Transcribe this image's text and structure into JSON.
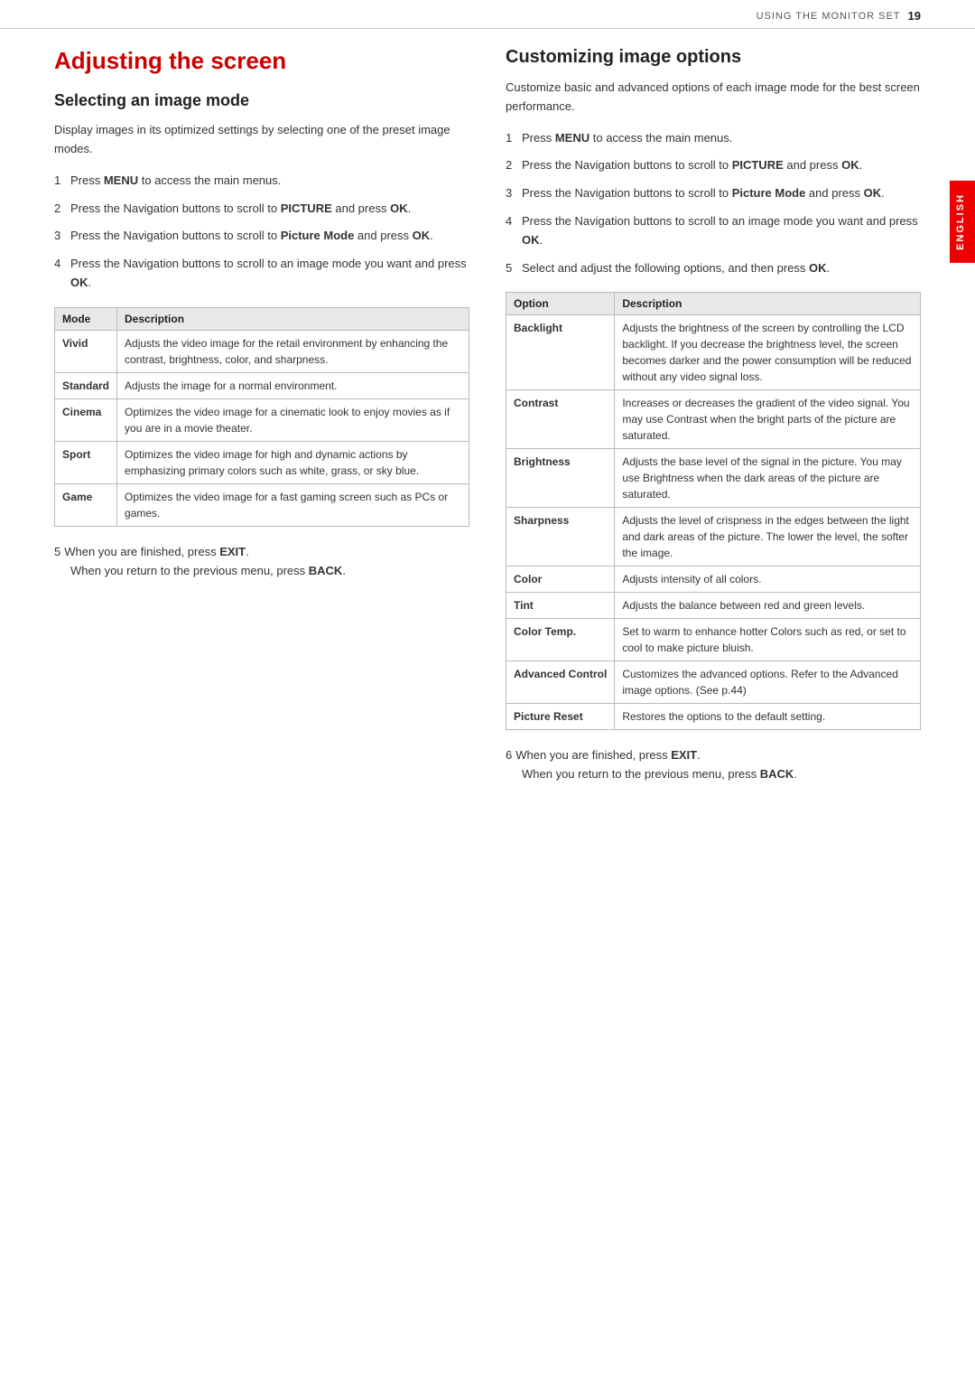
{
  "header": {
    "label": "USING THE MONITOR SET",
    "page_number": "19"
  },
  "english_tab": "ENGLISH",
  "left": {
    "main_title": "Adjusting the screen",
    "sub_title": "Selecting an image mode",
    "intro": "Display images in its optimized settings by selecting one of the preset image modes.",
    "steps": [
      {
        "num": "1",
        "text": "Press ",
        "bold": "MENU",
        "after": " to access the main menus."
      },
      {
        "num": "2",
        "text": "Press the Navigation buttons to scroll to ",
        "bold": "PICTURE",
        "after": " and press ",
        "bold2": "OK",
        "after2": "."
      },
      {
        "num": "3",
        "text": "Press the Navigation buttons to scroll to ",
        "bold": "Picture Mode",
        "after": " and press ",
        "bold2": "OK",
        "after2": "."
      },
      {
        "num": "4",
        "text": "Press the Navigation buttons to scroll to an image mode you want and press ",
        "bold": "OK",
        "after": "."
      }
    ],
    "table": {
      "headers": [
        "Mode",
        "Description"
      ],
      "rows": [
        {
          "mode": "Vivid",
          "desc": "Adjusts the video image for the retail environment by enhancing the contrast, brightness, color, and sharpness."
        },
        {
          "mode": "Standard",
          "desc": "Adjusts the image for a normal environment."
        },
        {
          "mode": "Cinema",
          "desc": "Optimizes the video image for a cinematic look to enjoy movies as if you are in a movie theater."
        },
        {
          "mode": "Sport",
          "desc": "Optimizes the video image for high and dynamic actions by emphasizing primary colors such as white, grass, or sky blue."
        },
        {
          "mode": "Game",
          "desc": "Optimizes the video image for a fast gaming screen such as PCs or games."
        }
      ]
    },
    "step5": {
      "num": "5",
      "line1": "When you are finished, press ",
      "bold1": "EXIT",
      "line1_end": ".",
      "line2": "When you return to the previous menu, press ",
      "bold2": "BACK",
      "line2_end": "."
    }
  },
  "right": {
    "sub_title": "Customizing image options",
    "intro": "Customize basic and advanced options of each image mode for the best screen performance.",
    "steps": [
      {
        "num": "1",
        "text": "Press ",
        "bold": "MENU",
        "after": " to access the main menus."
      },
      {
        "num": "2",
        "text": "Press the Navigation buttons to scroll to ",
        "bold": "PICTURE",
        "after": " and press ",
        "bold2": "OK",
        "after2": "."
      },
      {
        "num": "3",
        "text": "Press the Navigation buttons to scroll to ",
        "bold": "Picture Mode",
        "after": " and press ",
        "bold2": "OK",
        "after2": "."
      },
      {
        "num": "4",
        "text": "Press the Navigation buttons to scroll to an image mode you want and press ",
        "bold": "OK",
        "after": "."
      },
      {
        "num": "5",
        "text": "Select and adjust the following options, and then press ",
        "bold": "OK",
        "after": "."
      }
    ],
    "table": {
      "headers": [
        "Option",
        "Description"
      ],
      "rows": [
        {
          "option": "Backlight",
          "desc": "Adjusts the brightness of the screen by controlling the LCD backlight. If you decrease the brightness level, the screen becomes darker and the power consumption will be reduced without any video signal loss."
        },
        {
          "option": "Contrast",
          "desc": "Increases or decreases the gradient of the video signal. You may use Contrast when the bright parts of the picture are saturated."
        },
        {
          "option": "Brightness",
          "desc": "Adjusts the base level of the signal in the picture. You may use Brightness when the dark areas of the picture are saturated."
        },
        {
          "option": "Sharpness",
          "desc": "Adjusts the level of crispness in the edges between the light and dark areas of the picture. The lower the level, the softer the image."
        },
        {
          "option": "Color",
          "desc": "Adjusts intensity of all colors."
        },
        {
          "option": "Tint",
          "desc": "Adjusts the balance between red and green levels."
        },
        {
          "option": "Color Temp.",
          "desc": "Set to warm to enhance hotter Colors such as red, or set to cool to make picture bluish."
        },
        {
          "option": "Advanced Control",
          "desc": "Customizes the advanced options. Refer to the Advanced image options. (See p.44)"
        },
        {
          "option": "Picture Reset",
          "desc": "Restores the options to the default setting."
        }
      ]
    },
    "step6": {
      "num": "6",
      "line1": "When you are finished, press ",
      "bold1": "EXIT",
      "line1_end": ".",
      "line2": "When you return to the previous menu, press ",
      "bold2": "BACK",
      "line2_end": "."
    }
  }
}
